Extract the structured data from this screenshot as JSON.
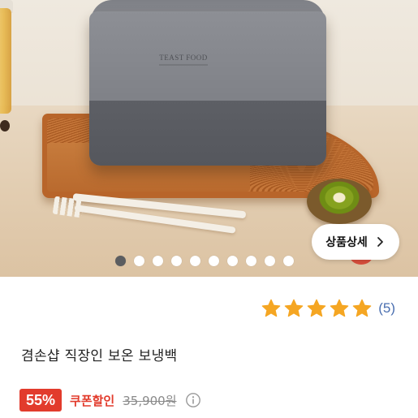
{
  "product_image": {
    "brand_text": "TEAST FOOD"
  },
  "detail_button": {
    "label": "상품상세",
    "icon": "chevron-right-icon"
  },
  "pager": {
    "total": 10,
    "active_index": 0
  },
  "rating": {
    "stars": 5,
    "count_text": "(5)",
    "star_color": "#F5A623"
  },
  "product": {
    "title": "겸손샵 직장인 보온 보냉백"
  },
  "price": {
    "discount_text": "55%",
    "coupon_label": "쿠폰할인",
    "original_price": "35,900원",
    "info_icon": "info-circle-icon"
  },
  "colors": {
    "accent_red": "#E23B2C",
    "link_blue": "#4A6FB0"
  }
}
